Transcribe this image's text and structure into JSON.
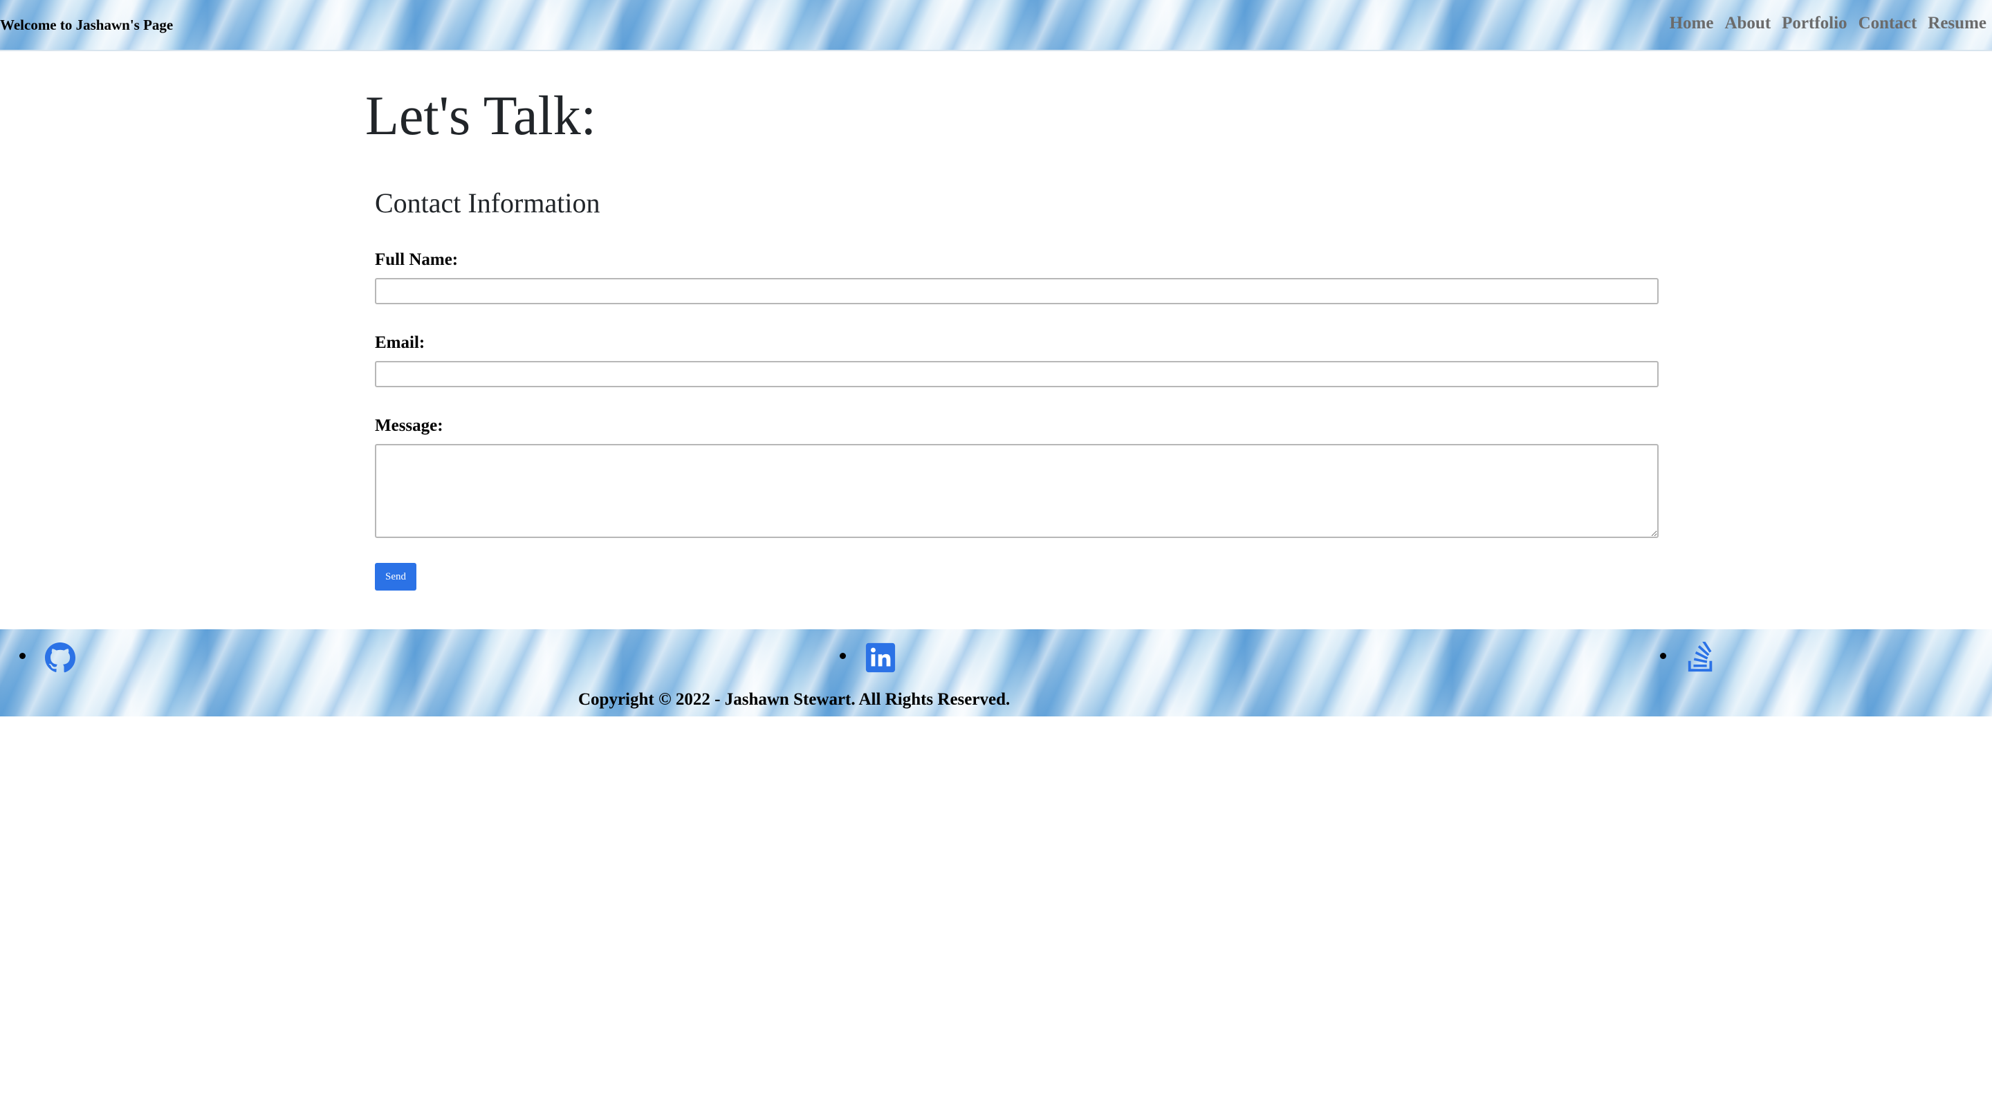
{
  "header": {
    "brand": "Welcome to Jashawn's Page",
    "nav": [
      "Home",
      "About",
      "Portfolio",
      "Contact",
      "Resume"
    ]
  },
  "main": {
    "title": "Let's Talk:",
    "section_title": "Contact Information",
    "fields": {
      "full_name_label": "Full Name:",
      "full_name_value": "",
      "email_label": "Email:",
      "email_value": "",
      "message_label": "Message:",
      "message_value": ""
    },
    "send_label": "Send"
  },
  "footer": {
    "social_icons": [
      "github-icon",
      "linkedin-icon",
      "stackoverflow-icon"
    ],
    "copyright": "Copyright © 2022 - Jashawn Stewart. All Rights Reserved."
  },
  "colors": {
    "accent": "#2b72e6",
    "nav_text": "#6b6b6b",
    "band": "#a9d3ec"
  }
}
